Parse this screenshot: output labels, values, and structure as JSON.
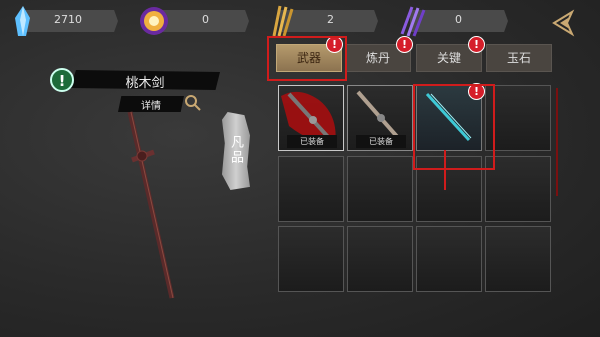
{
  "resources": [
    {
      "name": "blue-crystal",
      "value": "2710",
      "color": "#4fb3ff"
    },
    {
      "name": "gold-orb",
      "value": "0",
      "color": "#e9a63a"
    },
    {
      "name": "gold-swords",
      "value": "2",
      "color": "#d9a640"
    },
    {
      "name": "purple-claws",
      "value": "0",
      "color": "#8a5be0"
    }
  ],
  "tabs": [
    {
      "label": "武器",
      "active": true,
      "badge": "!"
    },
    {
      "label": "炼丹",
      "active": false,
      "badge": "!"
    },
    {
      "label": "关键",
      "active": false,
      "badge": "!"
    },
    {
      "label": "玉石",
      "active": false,
      "badge": ""
    }
  ],
  "item": {
    "title": "桃木剑",
    "detail_label": "详情",
    "grade": "凡品",
    "info_badge": "!"
  },
  "inventory": [
    {
      "type": "red-sword",
      "label": "已装备"
    },
    {
      "type": "silver-sword",
      "label": "已装备"
    },
    {
      "type": "cyan-sword",
      "label": "",
      "badge": "!"
    },
    {
      "type": "empty"
    },
    {
      "type": "empty"
    },
    {
      "type": "empty"
    },
    {
      "type": "empty"
    },
    {
      "type": "empty"
    },
    {
      "type": "empty"
    },
    {
      "type": "empty"
    },
    {
      "type": "empty"
    },
    {
      "type": "empty"
    }
  ],
  "colors": {
    "highlight": "#d01c1c",
    "badge": "#d51e2a",
    "active_tab": "#a88d60"
  }
}
